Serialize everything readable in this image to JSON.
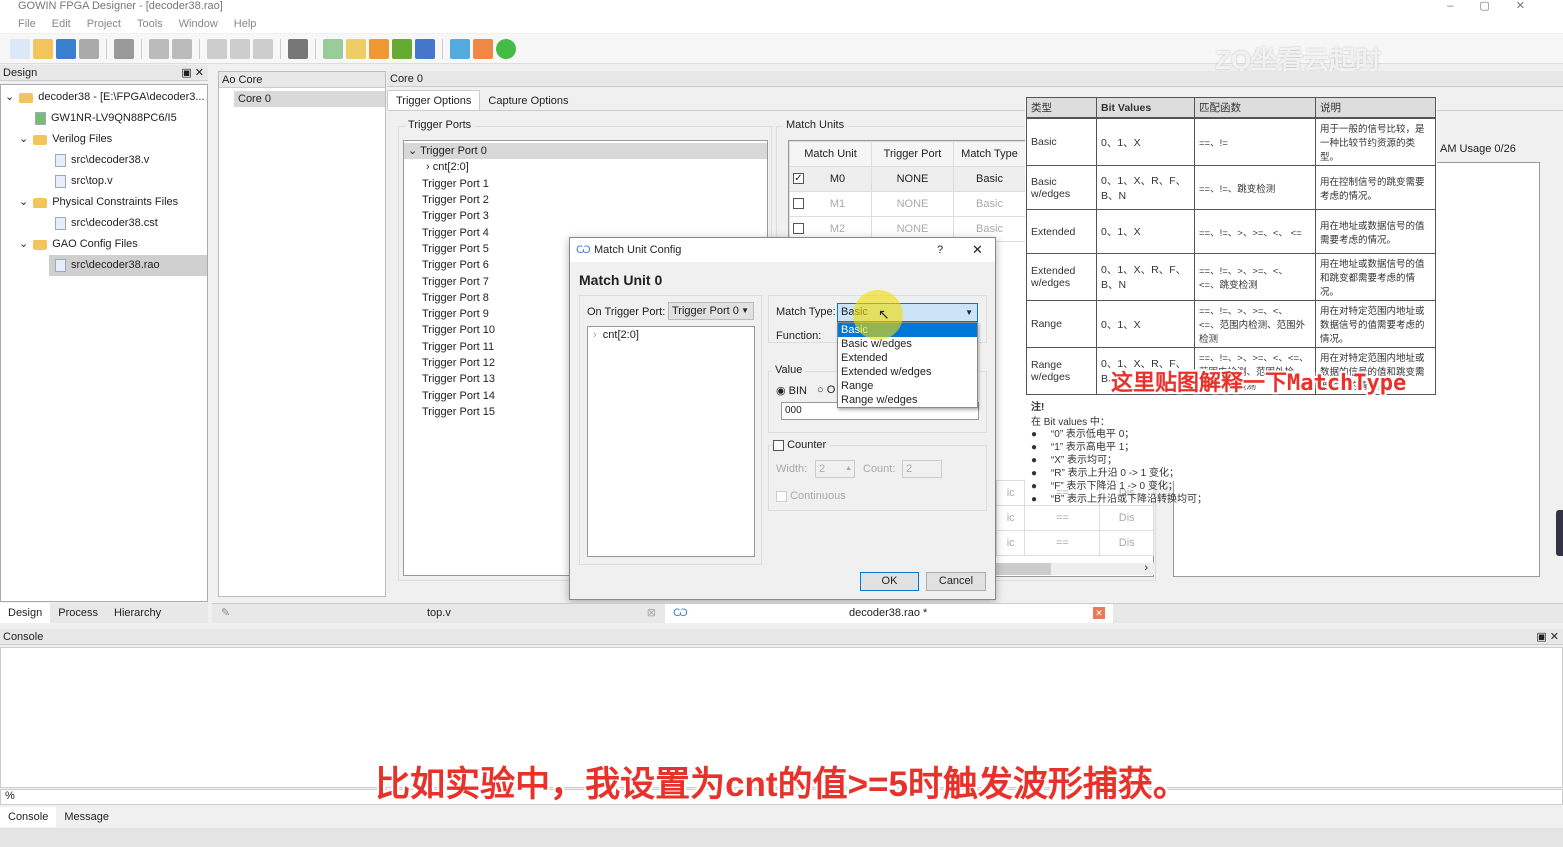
{
  "app": {
    "title": "GOWIN FPGA Designer - [decoder38.rao]",
    "menu": [
      "File",
      "Edit",
      "Project",
      "Tools",
      "Window",
      "Help"
    ],
    "watermark": "ZQ坐看云起时"
  },
  "design": {
    "title": "Design",
    "tree": [
      {
        "label": "decoder38 - [E:\\FPGA\\decoder3...",
        "type": "project",
        "level": 0
      },
      {
        "label": "GW1NR-LV9QN88PC6/I5",
        "type": "chip",
        "level": 1
      },
      {
        "label": "Verilog Files",
        "type": "folder",
        "level": 1
      },
      {
        "label": "src\\decoder38.v",
        "type": "file",
        "level": 2
      },
      {
        "label": "src\\top.v",
        "type": "file",
        "level": 2
      },
      {
        "label": "Physical Constraints Files",
        "type": "folder",
        "level": 1
      },
      {
        "label": "src\\decoder38.cst",
        "type": "file",
        "level": 2
      },
      {
        "label": "GAO Config Files",
        "type": "folder",
        "level": 1
      },
      {
        "label": "src\\decoder38.rao",
        "type": "file",
        "level": 2,
        "selected": true
      }
    ],
    "tabs": [
      "Design",
      "Process",
      "Hierarchy"
    ]
  },
  "ao": {
    "title": "Ao Core",
    "item": "Core 0"
  },
  "core": {
    "title": "Core 0",
    "tabs": [
      "Trigger Options",
      "Capture Options"
    ],
    "trigger_ports_title": "Trigger Ports",
    "ports": [
      "Trigger Port 0",
      "cnt[2:0]",
      "Trigger Port 1",
      "Trigger Port 2",
      "Trigger Port 3",
      "Trigger Port 4",
      "Trigger Port 5",
      "Trigger Port 6",
      "Trigger Port 7",
      "Trigger Port 8",
      "Trigger Port 9",
      "Trigger Port 10",
      "Trigger Port 11",
      "Trigger Port 12",
      "Trigger Port 13",
      "Trigger Port 14",
      "Trigger Port 15"
    ],
    "match_units_title": "Match Units",
    "mu_headers": [
      "Match Unit",
      "Trigger Port",
      "Match Type"
    ],
    "mu_rows": [
      {
        "checked": true,
        "unit": "M0",
        "port": "NONE",
        "type": "Basic"
      },
      {
        "checked": false,
        "unit": "M1",
        "port": "NONE",
        "type": "Basic"
      },
      {
        "checked": false,
        "unit": "M2",
        "port": "NONE",
        "type": "Basic"
      }
    ],
    "mu_lower_rows": [
      {
        "type": "ic",
        "func": "==",
        "en": "Dis"
      },
      {
        "type": "ic",
        "func": "==",
        "en": "Dis"
      },
      {
        "type": "ic",
        "func": "==",
        "en": "Dis"
      }
    ],
    "usage": "AM Usage 0/26"
  },
  "dialog": {
    "title": "Match Unit Config",
    "help": "?",
    "heading": "Match Unit 0",
    "on_port_label": "On Trigger Port:",
    "on_port_value": "Trigger Port 0",
    "port_tree": "cnt[2:0]",
    "match_type_label": "Match Type:",
    "match_type_value": "Basic",
    "function_label": "Function:",
    "options": [
      "Basic",
      "Basic w/edges",
      "Extended",
      "Extended w/edges",
      "Range",
      "Range w/edges"
    ],
    "value_label": "Value",
    "bin": "BIN",
    "oct": "O",
    "value": "000",
    "counter": "Counter",
    "width_label": "Width:",
    "width": "2",
    "count_label": "Count:",
    "count": "2",
    "continuous": "Continuous",
    "ok": "OK",
    "cancel": "Cancel"
  },
  "ref": {
    "headers": [
      "类型",
      "Bit Values",
      "匹配函数",
      "说明"
    ],
    "rows": [
      [
        "Basic",
        "0、1、X",
        "==、!=",
        "用于一般的信号比较，是一种比较节约资源的类型。"
      ],
      [
        "Basic w/edges",
        "0、1、X、R、F、B、N",
        "==、!=、跳变检测",
        "用在控制信号的跳变需要考虑的情况。"
      ],
      [
        "Extended",
        "0、1、X",
        "==、!=、>、>=、<、 <=",
        "用在地址或数据信号的值需要考虑的情况。"
      ],
      [
        "Extended w/edges",
        "0、1、X、R、F、B、N",
        "==、!=、>、>=、<、 <=、跳变检测",
        "用在地址或数据信号的值和跳变都需要考虑的情况。"
      ],
      [
        "Range",
        "0、1、X",
        "==、!=、>、>=、<、 <=、范围内检测、范围外检测",
        "用在对特定范围内地址或数据信号的值需要考虑的情况。"
      ],
      [
        "Range w/edges",
        "0、1、X、R、F、B、N",
        "==、!=、>、>=、<、<=、范围内检测、范围外检测、跳变检测",
        "用在对特定范围内地址或数据的信号的值和跳变需要考虑的情况。"
      ]
    ],
    "note_title": "注!",
    "note_intro": "在 Bit values 中：",
    "notes": [
      "“0” 表示低电平 0；",
      "“1” 表示高电平 1；",
      "“X” 表示均可；",
      "“R” 表示上升沿 0 -> 1 变化；",
      "“F” 表示下降沿 1 -> 0 变化；",
      "“B” 表示上升沿或下降沿转换均可；"
    ],
    "annotation": "这里贴图解释一下MatchType"
  },
  "editor_tabs": [
    "top.v",
    "decoder38.rao *"
  ],
  "console": {
    "title": "Console",
    "prompt": "%",
    "tabs": [
      "Console",
      "Message"
    ]
  },
  "subtitle": "比如实验中，我设置为cnt的值>=5时触发波形捕获。"
}
